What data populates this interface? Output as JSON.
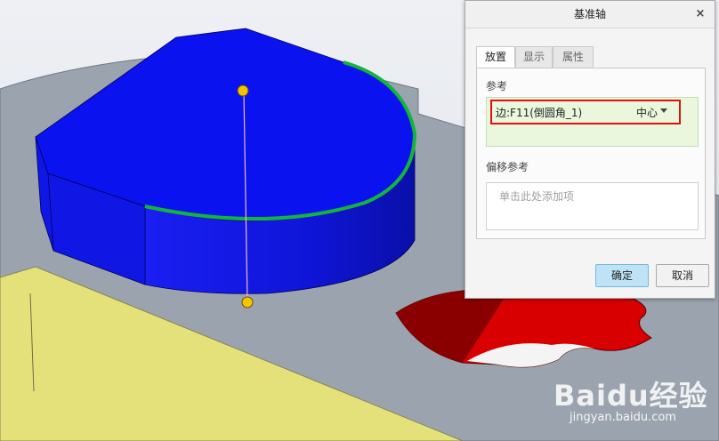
{
  "dialog": {
    "title": "基准轴",
    "close_glyph": "×",
    "tabs": [
      {
        "label": "放置",
        "active": true
      },
      {
        "label": "显示",
        "active": false
      },
      {
        "label": "属性",
        "active": false
      }
    ],
    "references": {
      "label": "参考",
      "item_text": "边:F11(倒圆角_1)",
      "constraint": "中心"
    },
    "offset_references": {
      "label": "偏移参考",
      "placeholder": "单击此处添加项"
    },
    "ok_label": "确定",
    "cancel_label": "取消"
  },
  "watermark": {
    "brand": "Baidu经验",
    "url": "jingyan.baidu.com"
  },
  "colors": {
    "part_blue": "#0a14f0",
    "highlight_green": "#14b43c",
    "cut_red": "#d40000",
    "base_gray": "#9aa3ad",
    "base_side_yellow": "#e6e27c",
    "point_yellow": "#f5c400",
    "selection_red": "#e01010",
    "ok_button": "#bfe3f6"
  },
  "icons": [
    "close-icon",
    "dropdown-caret-icon"
  ]
}
